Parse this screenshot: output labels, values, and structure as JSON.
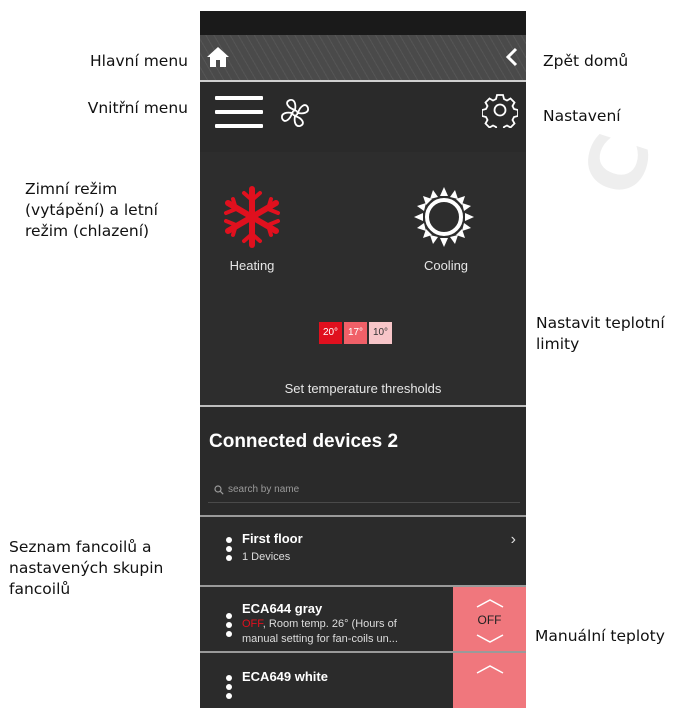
{
  "annotations": {
    "hlavni_menu": "Hlavní menu",
    "vnitrni_menu": "Vnitřní menu",
    "mode_line1": "Zimní režim",
    "mode_line2": "(vytápění) a letní",
    "mode_line3": "režim (chlazení)",
    "list_line1": "Seznam fancoilů a",
    "list_line2": "nastavených skupin",
    "list_line3": "fancoilů",
    "zpet_domu": "Zpět domů",
    "nastaveni": "Nastavení",
    "limits_line1": "Nastavit teplotní",
    "limits_line2": "limity",
    "manual": "Manuální teploty"
  },
  "icons": {
    "home": "home-icon",
    "back": "chevron-left-icon",
    "menu": "hamburger-icon",
    "fan": "fan-icon",
    "settings": "gear-icon",
    "heating": "snowflake-icon",
    "cooling": "sun-icon",
    "search": "search-icon"
  },
  "colors": {
    "heating_red": "#e0101e",
    "off_panel": "#f0777d",
    "off_status": "#e0101e"
  },
  "modes": {
    "heating_label": "Heating",
    "cooling_label": "Cooling"
  },
  "thresholds": {
    "values": [
      "20°",
      "17°",
      "10°"
    ],
    "label": "Set temperature thresholds"
  },
  "devices": {
    "title": "Connected devices 2",
    "search_placeholder": "search by name",
    "group": {
      "name": "First floor",
      "count": "1 Devices"
    },
    "items": [
      {
        "name": "ECA644 gray",
        "status": "OFF",
        "details_line1": ", Room temp. 26° (Hours of",
        "details_line2": "manual setting for fan-coils un...",
        "button": "OFF"
      },
      {
        "name": "ECA649 white"
      }
    ]
  }
}
